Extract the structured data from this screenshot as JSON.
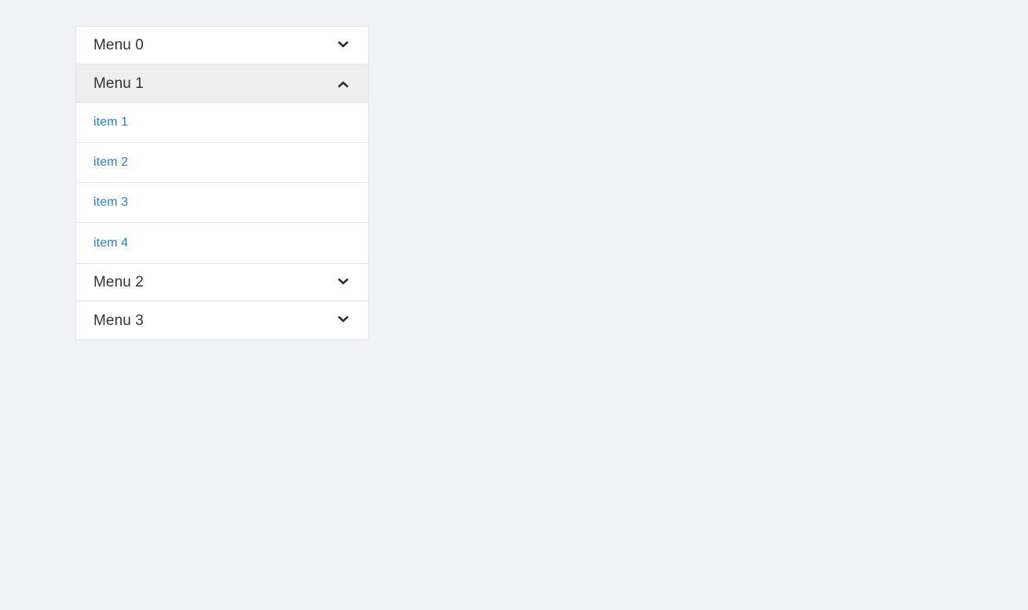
{
  "page": {
    "background_color": "#f0f2f5"
  },
  "accordion": {
    "border_color": "#e2e2e4",
    "link_color": "#337ab7",
    "header_text_color": "#333333",
    "expanded_header_background": "#eeeeee",
    "panels": [
      {
        "title": "Menu 0",
        "expanded": false,
        "icon": "chevron-down-icon",
        "items": []
      },
      {
        "title": "Menu 1",
        "expanded": true,
        "icon": "chevron-up-icon",
        "items": [
          {
            "label": "item 1"
          },
          {
            "label": "item 2"
          },
          {
            "label": "item 3"
          },
          {
            "label": "item 4"
          }
        ]
      },
      {
        "title": "Menu 2",
        "expanded": false,
        "icon": "chevron-down-icon",
        "items": []
      },
      {
        "title": "Menu 3",
        "expanded": false,
        "icon": "chevron-down-icon",
        "items": []
      }
    ]
  }
}
